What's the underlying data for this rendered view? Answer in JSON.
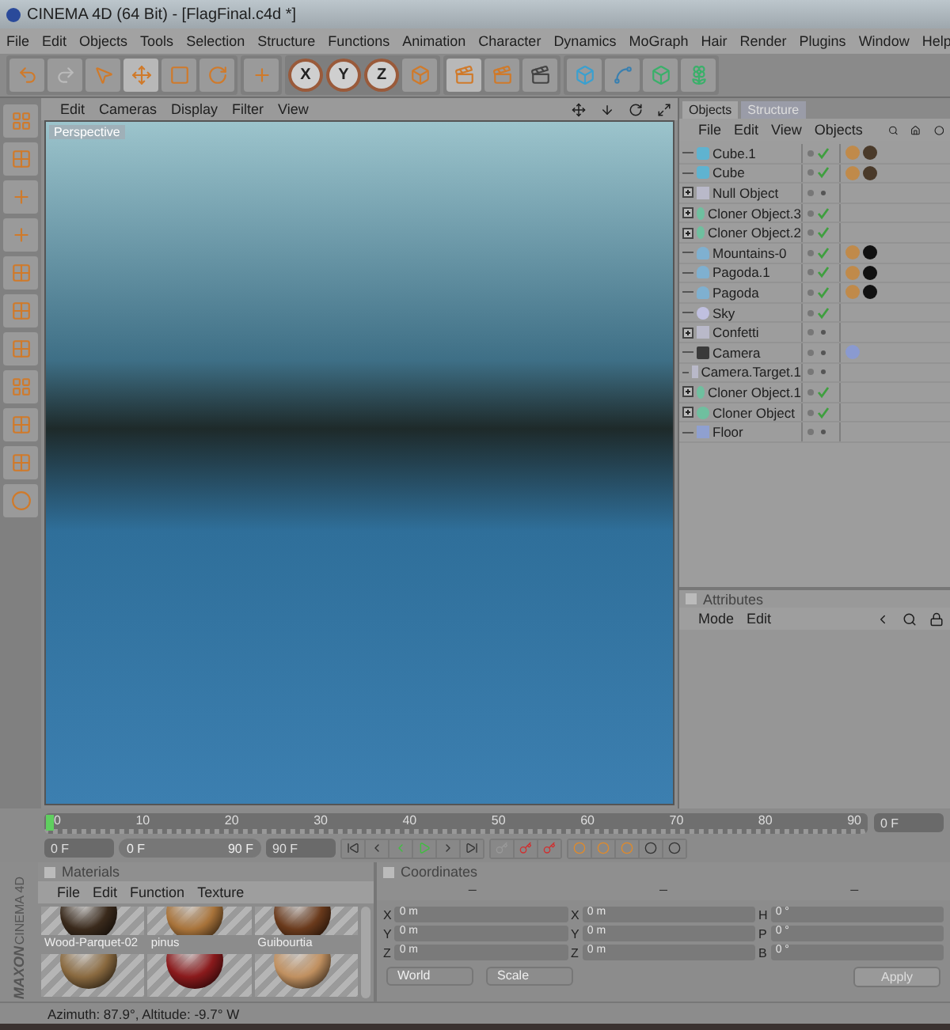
{
  "window": {
    "title": "CINEMA 4D (64 Bit) - [FlagFinal.c4d *]"
  },
  "menu": [
    "File",
    "Edit",
    "Objects",
    "Tools",
    "Selection",
    "Structure",
    "Functions",
    "Animation",
    "Character",
    "Dynamics",
    "MoGraph",
    "Hair",
    "Render",
    "Plugins",
    "Window",
    "Help"
  ],
  "toolbar": {
    "axis_locks": [
      "X",
      "Y",
      "Z"
    ]
  },
  "viewport": {
    "menu": [
      "Edit",
      "Cameras",
      "Display",
      "Filter",
      "View"
    ],
    "label": "Perspective"
  },
  "objects_panel": {
    "tabs": [
      {
        "label": "Objects",
        "selected": true
      },
      {
        "label": "Structure",
        "selected": false
      }
    ],
    "menu": [
      "File",
      "Edit",
      "View",
      "Objects"
    ],
    "items": [
      {
        "name": "Cube.1",
        "kind": "cube",
        "expandable": false,
        "checked": true,
        "tags": [
          {
            "kind": "material"
          },
          {
            "kind": "texture"
          }
        ]
      },
      {
        "name": "Cube",
        "kind": "cube",
        "expandable": false,
        "checked": true,
        "tags": [
          {
            "kind": "material"
          },
          {
            "kind": "texture"
          }
        ]
      },
      {
        "name": "Null Object",
        "kind": "null",
        "expandable": true,
        "checked": false
      },
      {
        "name": "Cloner Object.3",
        "kind": "cloner",
        "expandable": true,
        "checked": true
      },
      {
        "name": "Cloner Object.2",
        "kind": "cloner",
        "expandable": true,
        "checked": true
      },
      {
        "name": "Mountains-0",
        "kind": "mesh",
        "expandable": false,
        "checked": true,
        "tags": [
          {
            "kind": "material"
          },
          {
            "kind": "dark"
          }
        ]
      },
      {
        "name": "Pagoda.1",
        "kind": "mesh",
        "expandable": false,
        "checked": true,
        "tags": [
          {
            "kind": "material"
          },
          {
            "kind": "dark"
          }
        ]
      },
      {
        "name": "Pagoda",
        "kind": "mesh",
        "expandable": false,
        "checked": true,
        "tags": [
          {
            "kind": "material"
          },
          {
            "kind": "dark"
          }
        ]
      },
      {
        "name": "Sky",
        "kind": "sky",
        "expandable": false,
        "checked": true
      },
      {
        "name": "Confetti",
        "kind": "null",
        "expandable": true,
        "checked": false
      },
      {
        "name": "Camera",
        "kind": "camera",
        "expandable": false,
        "checked": false,
        "tags": [
          {
            "kind": "target"
          }
        ]
      },
      {
        "name": "Camera.Target.1",
        "kind": "null",
        "expandable": false,
        "checked": false
      },
      {
        "name": "Cloner Object.1",
        "kind": "cloner",
        "expandable": true,
        "checked": true
      },
      {
        "name": "Cloner Object",
        "kind": "cloner",
        "expandable": true,
        "checked": true
      },
      {
        "name": "Floor",
        "kind": "floor",
        "expandable": false,
        "checked": false
      }
    ]
  },
  "attributes_panel": {
    "title": "Attributes",
    "menu": [
      "Mode",
      "Edit"
    ]
  },
  "timeline": {
    "ticks": [
      "0",
      "10",
      "20",
      "30",
      "40",
      "50",
      "60",
      "70",
      "80",
      "90"
    ],
    "current": "0 F",
    "start": "0 F",
    "range_start": "0 F",
    "range_end": "90 F",
    "end": "90 F"
  },
  "materials_panel": {
    "title": "Materials",
    "menu": [
      "File",
      "Edit",
      "Function",
      "Texture"
    ],
    "materials": [
      {
        "name": "Wood-Parquet-02",
        "color": "#3a2a1c"
      },
      {
        "name": "pinus",
        "color": "#a8733a"
      },
      {
        "name": "Guibourtia",
        "color": "#6a3a1c"
      },
      {
        "color": "#8a6a40"
      },
      {
        "color": "#8a1a1c"
      },
      {
        "color": "#c09060"
      }
    ]
  },
  "coordinates_panel": {
    "title": "Coordinates",
    "headers": [
      "–",
      "–",
      "–"
    ],
    "rows": [
      {
        "a": "X",
        "a_value": "0 m",
        "b": "X",
        "b_value": "0 m",
        "c": "H",
        "c_value": "0 °"
      },
      {
        "a": "Y",
        "a_value": "0 m",
        "b": "Y",
        "b_value": "0 m",
        "c": "P",
        "c_value": "0 °"
      },
      {
        "a": "Z",
        "a_value": "0 m",
        "b": "Z",
        "b_value": "0 m",
        "c": "B",
        "c_value": "0 °"
      }
    ],
    "mode": "World",
    "scale": "Scale",
    "apply": "Apply"
  },
  "logo": {
    "brand": "MAXON",
    "product": "CINEMA 4D"
  },
  "status_bar": "Azimuth: 87.9°, Altitude: -9.7°  W"
}
